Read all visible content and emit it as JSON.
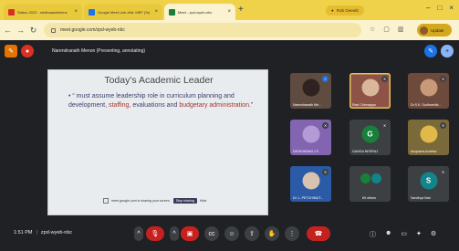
{
  "browser": {
    "tabs": [
      {
        "label": "Status 2023 - shidhaansilienne",
        "favicon_color": "#d93025",
        "active": false
      },
      {
        "label": "Google Meet Link ###: MEF (%)",
        "favicon_color": "#1a73e8",
        "active": false
      },
      {
        "label": "Meet - zpd-wyeb-nbc",
        "favicon_color": "#188038",
        "active": true
      }
    ],
    "new_tab": "+",
    "profile_pill": "Rob Geenitt",
    "url": "meet.google.com/zpd-wyeb-nbc",
    "update_label": "Update",
    "window_controls": [
      "–",
      "□",
      "×"
    ]
  },
  "meet": {
    "presenting_label": "Narendranath Menon (Presenting, annotating)",
    "slide": {
      "title": "Today's Academic Leader",
      "bullet_prefix": "• “ must assume leadership role in curriculum planning and development, ",
      "staffing": "staffing,",
      "middle": " evaluations and ",
      "budgetary": "budgetary administration",
      "suffix": ".”",
      "share_notice": "meet.google.com is sharing your screen.",
      "stop_sharing": "Stop sharing",
      "hide": "Hide"
    },
    "participants": [
      {
        "name": "Narendranath Me...",
        "type": "photo",
        "bg": "#5f4b3f",
        "mic_active": true
      },
      {
        "name": "Ravi Chinnappa",
        "type": "photo",
        "bg": "#8d5346",
        "mic_active": false
      },
      {
        "name": "Dr.S.K. Sudharshik...",
        "type": "photo",
        "bg": "#6d4a3b",
        "mic_active": false
      },
      {
        "name": "DEVIKARANI J S",
        "type": "photo",
        "bg": "#8264b0",
        "mic_active": false
      },
      {
        "name": "GANGA NEERAJ",
        "type": "initial",
        "initial": "G",
        "bg": "#3c4043",
        "avatar_bg": "#188038",
        "mic_active": false
      },
      {
        "name": "Anupama Andrew",
        "type": "photo",
        "bg": "#7a6a3a",
        "mic_active": false
      },
      {
        "name": "Dr. L. PETCHIMUT...",
        "type": "photo",
        "bg": "#2b5aa6",
        "mic_active": false
      },
      {
        "name": "69 others",
        "type": "others",
        "bg": "#3c4043",
        "mic_active": false
      },
      {
        "name": "Sandhya Nair",
        "type": "initial",
        "initial": "S",
        "bg": "#3c4043",
        "avatar_bg": "#12848a",
        "mic_active": false
      }
    ],
    "time": "1:51 PM",
    "separator": "|",
    "meeting_code": "zpd-wyeb-nbc"
  }
}
